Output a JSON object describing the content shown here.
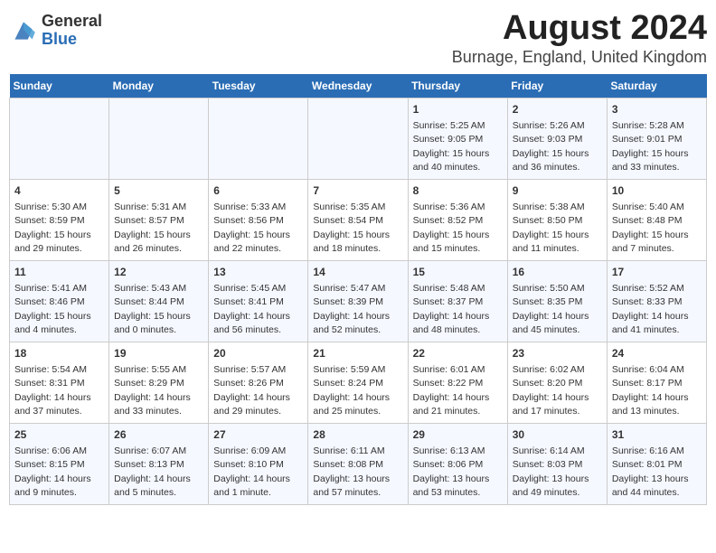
{
  "header": {
    "logo_general": "General",
    "logo_blue": "Blue",
    "title": "August 2024",
    "subtitle": "Burnage, England, United Kingdom"
  },
  "days_of_week": [
    "Sunday",
    "Monday",
    "Tuesday",
    "Wednesday",
    "Thursday",
    "Friday",
    "Saturday"
  ],
  "weeks": [
    [
      {
        "day": "",
        "info": ""
      },
      {
        "day": "",
        "info": ""
      },
      {
        "day": "",
        "info": ""
      },
      {
        "day": "",
        "info": ""
      },
      {
        "day": "1",
        "info": "Sunrise: 5:25 AM\nSunset: 9:05 PM\nDaylight: 15 hours\nand 40 minutes."
      },
      {
        "day": "2",
        "info": "Sunrise: 5:26 AM\nSunset: 9:03 PM\nDaylight: 15 hours\nand 36 minutes."
      },
      {
        "day": "3",
        "info": "Sunrise: 5:28 AM\nSunset: 9:01 PM\nDaylight: 15 hours\nand 33 minutes."
      }
    ],
    [
      {
        "day": "4",
        "info": "Sunrise: 5:30 AM\nSunset: 8:59 PM\nDaylight: 15 hours\nand 29 minutes."
      },
      {
        "day": "5",
        "info": "Sunrise: 5:31 AM\nSunset: 8:57 PM\nDaylight: 15 hours\nand 26 minutes."
      },
      {
        "day": "6",
        "info": "Sunrise: 5:33 AM\nSunset: 8:56 PM\nDaylight: 15 hours\nand 22 minutes."
      },
      {
        "day": "7",
        "info": "Sunrise: 5:35 AM\nSunset: 8:54 PM\nDaylight: 15 hours\nand 18 minutes."
      },
      {
        "day": "8",
        "info": "Sunrise: 5:36 AM\nSunset: 8:52 PM\nDaylight: 15 hours\nand 15 minutes."
      },
      {
        "day": "9",
        "info": "Sunrise: 5:38 AM\nSunset: 8:50 PM\nDaylight: 15 hours\nand 11 minutes."
      },
      {
        "day": "10",
        "info": "Sunrise: 5:40 AM\nSunset: 8:48 PM\nDaylight: 15 hours\nand 7 minutes."
      }
    ],
    [
      {
        "day": "11",
        "info": "Sunrise: 5:41 AM\nSunset: 8:46 PM\nDaylight: 15 hours\nand 4 minutes."
      },
      {
        "day": "12",
        "info": "Sunrise: 5:43 AM\nSunset: 8:44 PM\nDaylight: 15 hours\nand 0 minutes."
      },
      {
        "day": "13",
        "info": "Sunrise: 5:45 AM\nSunset: 8:41 PM\nDaylight: 14 hours\nand 56 minutes."
      },
      {
        "day": "14",
        "info": "Sunrise: 5:47 AM\nSunset: 8:39 PM\nDaylight: 14 hours\nand 52 minutes."
      },
      {
        "day": "15",
        "info": "Sunrise: 5:48 AM\nSunset: 8:37 PM\nDaylight: 14 hours\nand 48 minutes."
      },
      {
        "day": "16",
        "info": "Sunrise: 5:50 AM\nSunset: 8:35 PM\nDaylight: 14 hours\nand 45 minutes."
      },
      {
        "day": "17",
        "info": "Sunrise: 5:52 AM\nSunset: 8:33 PM\nDaylight: 14 hours\nand 41 minutes."
      }
    ],
    [
      {
        "day": "18",
        "info": "Sunrise: 5:54 AM\nSunset: 8:31 PM\nDaylight: 14 hours\nand 37 minutes."
      },
      {
        "day": "19",
        "info": "Sunrise: 5:55 AM\nSunset: 8:29 PM\nDaylight: 14 hours\nand 33 minutes."
      },
      {
        "day": "20",
        "info": "Sunrise: 5:57 AM\nSunset: 8:26 PM\nDaylight: 14 hours\nand 29 minutes."
      },
      {
        "day": "21",
        "info": "Sunrise: 5:59 AM\nSunset: 8:24 PM\nDaylight: 14 hours\nand 25 minutes."
      },
      {
        "day": "22",
        "info": "Sunrise: 6:01 AM\nSunset: 8:22 PM\nDaylight: 14 hours\nand 21 minutes."
      },
      {
        "day": "23",
        "info": "Sunrise: 6:02 AM\nSunset: 8:20 PM\nDaylight: 14 hours\nand 17 minutes."
      },
      {
        "day": "24",
        "info": "Sunrise: 6:04 AM\nSunset: 8:17 PM\nDaylight: 14 hours\nand 13 minutes."
      }
    ],
    [
      {
        "day": "25",
        "info": "Sunrise: 6:06 AM\nSunset: 8:15 PM\nDaylight: 14 hours\nand 9 minutes."
      },
      {
        "day": "26",
        "info": "Sunrise: 6:07 AM\nSunset: 8:13 PM\nDaylight: 14 hours\nand 5 minutes."
      },
      {
        "day": "27",
        "info": "Sunrise: 6:09 AM\nSunset: 8:10 PM\nDaylight: 14 hours\nand 1 minute."
      },
      {
        "day": "28",
        "info": "Sunrise: 6:11 AM\nSunset: 8:08 PM\nDaylight: 13 hours\nand 57 minutes."
      },
      {
        "day": "29",
        "info": "Sunrise: 6:13 AM\nSunset: 8:06 PM\nDaylight: 13 hours\nand 53 minutes."
      },
      {
        "day": "30",
        "info": "Sunrise: 6:14 AM\nSunset: 8:03 PM\nDaylight: 13 hours\nand 49 minutes."
      },
      {
        "day": "31",
        "info": "Sunrise: 6:16 AM\nSunset: 8:01 PM\nDaylight: 13 hours\nand 44 minutes."
      }
    ]
  ]
}
